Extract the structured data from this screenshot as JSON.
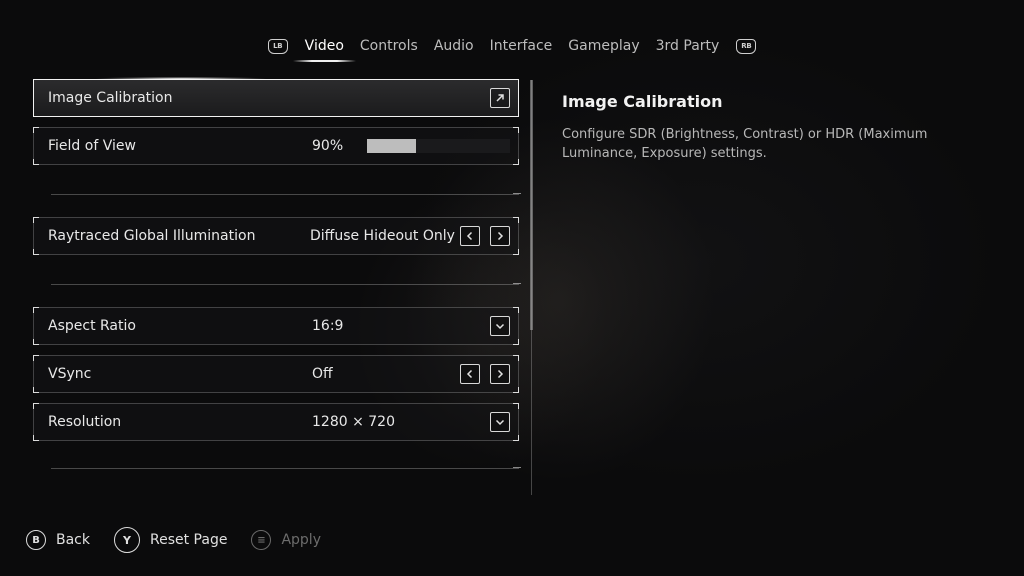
{
  "tabs": {
    "left_bumper": "LB",
    "right_bumper": "RB",
    "items": [
      "Video",
      "Controls",
      "Audio",
      "Interface",
      "Gameplay",
      "3rd Party"
    ],
    "active_index": 0
  },
  "settings": {
    "image_calibration": {
      "label": "Image Calibration",
      "icon": "external-link-icon"
    },
    "field_of_view": {
      "label": "Field of View",
      "value": "90%",
      "slider_fraction": 0.34
    },
    "raytraced_gi": {
      "label": "Raytraced Global Illumination",
      "value": "Diffuse Hideout Only"
    },
    "aspect_ratio": {
      "label": "Aspect Ratio",
      "value": "16:9"
    },
    "vsync": {
      "label": "VSync",
      "value": "Off"
    },
    "resolution": {
      "label": "Resolution",
      "value": "1280 × 720"
    }
  },
  "description": {
    "title": "Image Calibration",
    "text": "Configure SDR (Brightness, Contrast) or HDR (Maximum Luminance, Exposure) settings."
  },
  "footer": {
    "back": {
      "glyph": "B",
      "label": "Back"
    },
    "reset": {
      "glyph": "Y",
      "label": "Reset Page"
    },
    "apply": {
      "glyph": "≡",
      "label": "Apply"
    }
  }
}
